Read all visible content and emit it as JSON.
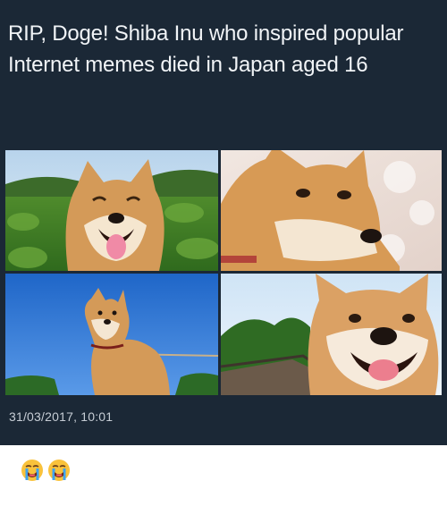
{
  "post": {
    "text": "RIP, Doge! Shiba Inu who inspired popular Internet memes died in Japan aged 16",
    "timestamp": "31/03/2017, 10:01",
    "photos": [
      {
        "subject": "smiling shiba inu in field",
        "name": "photo-shiba-field"
      },
      {
        "subject": "shiba inu side-eye",
        "name": "photo-shiba-side-eye"
      },
      {
        "subject": "shiba inu on leash under blue sky",
        "name": "photo-shiba-leash"
      },
      {
        "subject": "shiba inu close-up smiling",
        "name": "photo-shiba-closeup"
      }
    ]
  },
  "reaction": {
    "emojis": [
      "loudly-crying-face-icon",
      "loudly-crying-face-icon"
    ]
  },
  "colors": {
    "post_background": "#1b2836",
    "post_text": "#f1f4f7",
    "timestamp_text": "#c6cdd5",
    "page_background": "#ffffff"
  }
}
